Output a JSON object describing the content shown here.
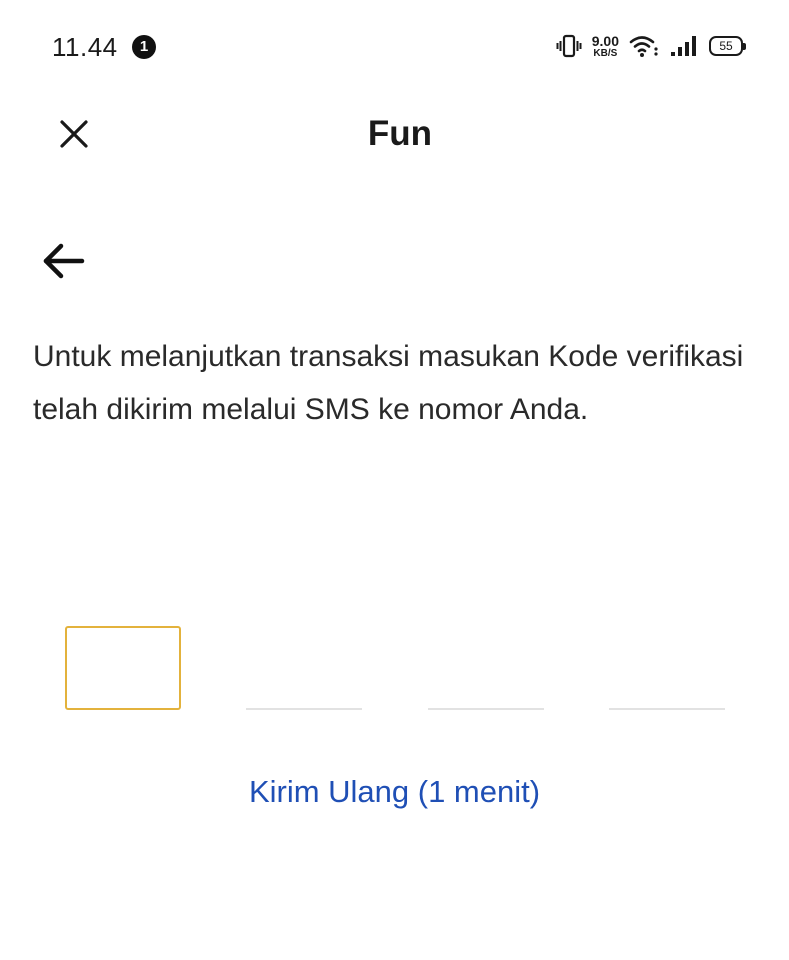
{
  "status_bar": {
    "time": "11.44",
    "notification_count": "1",
    "net_speed_value": "9.00",
    "net_speed_unit": "KB/S",
    "battery_level": "55"
  },
  "header": {
    "title": "Fun",
    "close_icon": "close-icon",
    "back_icon": "arrow-left-icon"
  },
  "instruction": "Untuk melanjutkan transaksi masukan Kode verifikasi telah dikirim melalui SMS ke nomor Anda.",
  "otp": {
    "digits": [
      "",
      "",
      "",
      ""
    ],
    "active_index": 0,
    "active_border_color": "#e3b23c",
    "inactive_line_color": "#e2e2e2"
  },
  "resend": {
    "label": "Kirim Ulang (1 menit)",
    "color": "#1f4fb5"
  }
}
